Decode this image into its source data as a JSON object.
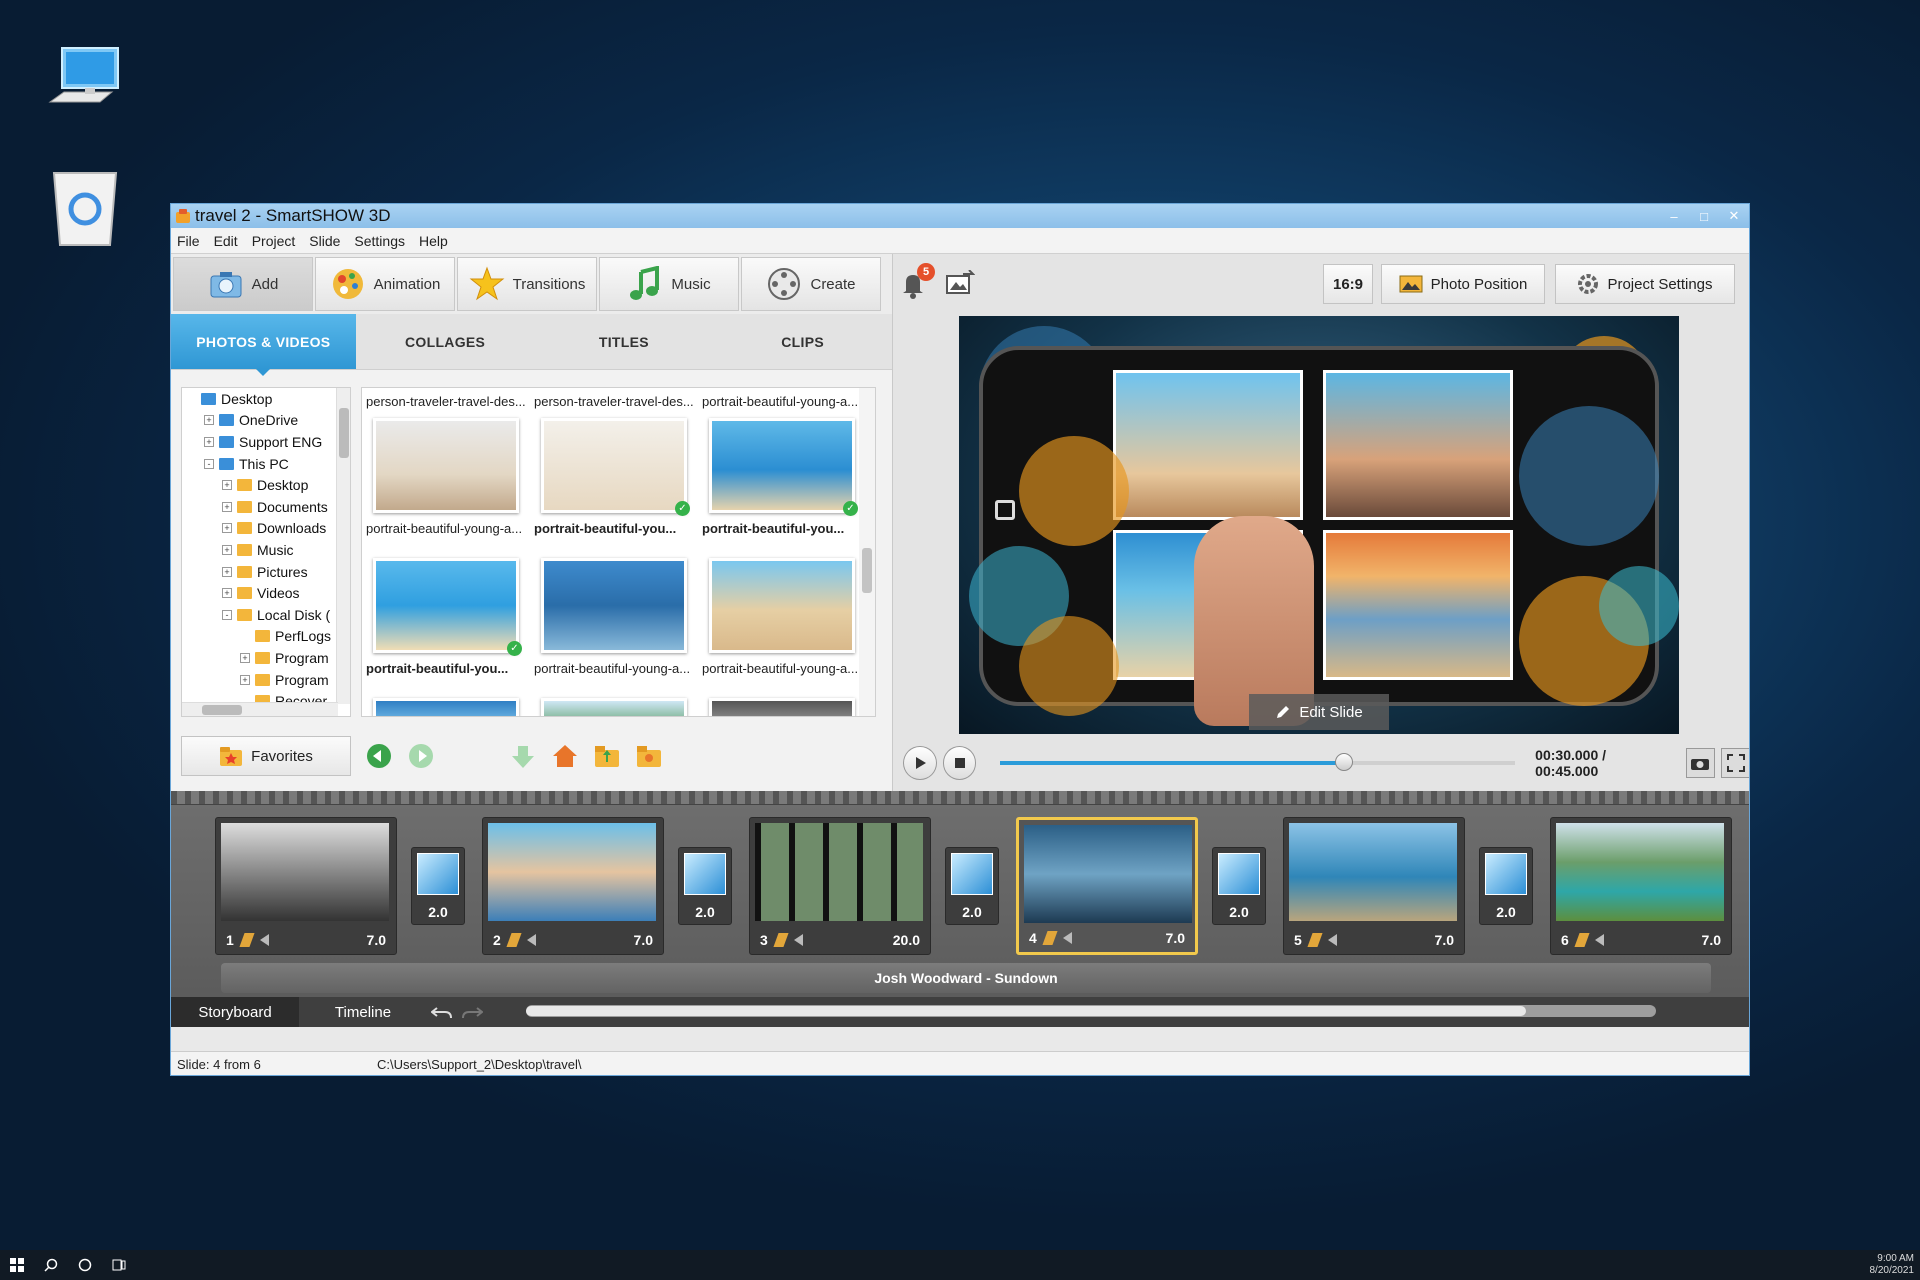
{
  "window": {
    "title": "travel 2 - SmartSHOW 3D",
    "controls": [
      "–",
      "□",
      "✕"
    ]
  },
  "menu": [
    "File",
    "Edit",
    "Project",
    "Slide",
    "Settings",
    "Help"
  ],
  "toolbar": {
    "add": "Add",
    "animation": "Animation",
    "transitions": "Transitions",
    "music": "Music",
    "create": "Create"
  },
  "tabs": [
    "PHOTOS & VIDEOS",
    "COLLAGES",
    "TITLES",
    "CLIPS"
  ],
  "tree": [
    {
      "label": "Desktop",
      "depth": 0,
      "toggle": ""
    },
    {
      "label": "OneDrive",
      "depth": 1,
      "toggle": "+"
    },
    {
      "label": "Support ENG",
      "depth": 1,
      "toggle": "+"
    },
    {
      "label": "This PC",
      "depth": 1,
      "toggle": "-"
    },
    {
      "label": "Desktop",
      "depth": 2,
      "toggle": "+"
    },
    {
      "label": "Documents",
      "depth": 2,
      "toggle": "+"
    },
    {
      "label": "Downloads",
      "depth": 2,
      "toggle": "+"
    },
    {
      "label": "Music",
      "depth": 2,
      "toggle": "+"
    },
    {
      "label": "Pictures",
      "depth": 2,
      "toggle": "+"
    },
    {
      "label": "Videos",
      "depth": 2,
      "toggle": "+"
    },
    {
      "label": "Local Disk (",
      "depth": 2,
      "toggle": "-"
    },
    {
      "label": "PerfLogs",
      "depth": 3,
      "toggle": ""
    },
    {
      "label": "Program",
      "depth": 3,
      "toggle": "+"
    },
    {
      "label": "Program",
      "depth": 3,
      "toggle": "+"
    },
    {
      "label": "Recover",
      "depth": 3,
      "toggle": ""
    }
  ],
  "grid_top_captions": [
    "person-traveler-travel-des...",
    "person-traveler-travel-des...",
    "portrait-beautiful-young-a..."
  ],
  "grid": [
    {
      "caption": "portrait-beautiful-young-a...",
      "bold": false,
      "used": false
    },
    {
      "caption": "portrait-beautiful-you...",
      "bold": true,
      "used": true
    },
    {
      "caption": "portrait-beautiful-you...",
      "bold": true,
      "used": true
    },
    {
      "caption": "portrait-beautiful-you...",
      "bold": true,
      "used": true
    },
    {
      "caption": "portrait-beautiful-young-a...",
      "bold": false,
      "used": false
    },
    {
      "caption": "portrait-beautiful-young-a...",
      "bold": false,
      "used": false
    }
  ],
  "favorites_label": "Favorites",
  "notifications_count": "5",
  "aspect_ratio": "16:9",
  "photo_position": "Photo Position",
  "project_settings": "Project Settings",
  "edit_slide": "Edit Slide",
  "playback": {
    "timecode": "00:30.000 / 00:45.000",
    "progress": 0.667
  },
  "slides": [
    {
      "num": "1",
      "duration": "7.0",
      "selected": false
    },
    {
      "num": "2",
      "duration": "7.0",
      "selected": false
    },
    {
      "num": "3",
      "duration": "20.0",
      "selected": false
    },
    {
      "num": "4",
      "duration": "7.0",
      "selected": true
    },
    {
      "num": "5",
      "duration": "7.0",
      "selected": false
    },
    {
      "num": "6",
      "duration": "7.0",
      "selected": false
    }
  ],
  "transitions": [
    "2.0",
    "2.0",
    "2.0",
    "2.0",
    "2.0"
  ],
  "music_track": "Josh Woodward - Sundown",
  "view_tabs": {
    "storyboard": "Storyboard",
    "timeline": "Timeline"
  },
  "status": {
    "slide": "Slide: 4 from 6",
    "path": "C:\\Users\\Support_2\\Desktop\\travel\\"
  },
  "taskbar_clock": {
    "time": "9:00 AM",
    "date": "8/20/2021"
  },
  "colors": {
    "accent": "#2f97d4",
    "selected_slide": "#f2c94c",
    "title_bar": "#9ccaee"
  }
}
